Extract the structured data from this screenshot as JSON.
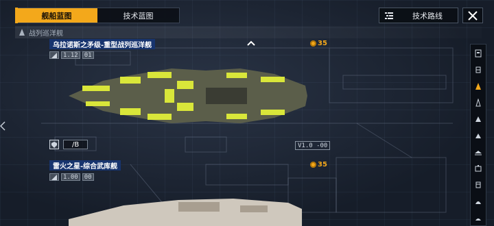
{
  "tabs": [
    {
      "label": "舰船蓝图",
      "active": true
    },
    {
      "label": "技术蓝图",
      "active": false
    }
  ],
  "route_button": {
    "label": "技术路线"
  },
  "category": {
    "label": "战列巡洋舰"
  },
  "ships": [
    {
      "name": "乌拉诺斯之矛级-重型战列巡洋舰",
      "level": "1.12",
      "level_extra": "01",
      "cost": "35",
      "slot_label": "/B",
      "version": "V1.0 -00"
    },
    {
      "name": "雷火之星-综合武库舰",
      "level": "1.00",
      "level_extra": "00",
      "cost": "35"
    }
  ],
  "rail_icons": [
    "carrier-icon",
    "cruiser-icon",
    "battlecruiser-icon",
    "frigate-icon",
    "destroyer-icon",
    "corvette-icon",
    "support-icon",
    "station-icon",
    "dome-icon",
    "base-icon",
    "outpost-icon"
  ],
  "colors": {
    "accent": "#f3a81b",
    "name_bg": "#17346e",
    "ship_yellow": "#d9e63a"
  }
}
